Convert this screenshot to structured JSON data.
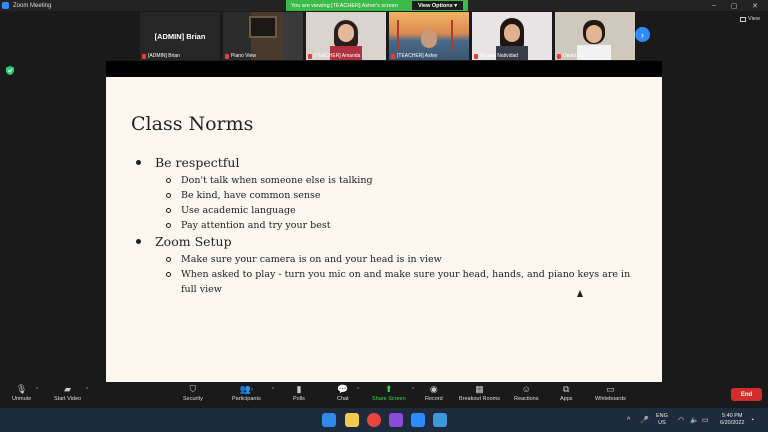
{
  "window": {
    "title": "Zoom Meeting"
  },
  "banner": {
    "text": "You are viewing [TEACHER] Asher's screen",
    "view_options": "View Options ▾"
  },
  "gallery": {
    "admin_name": "[ADMIN] Brian",
    "tiles": [
      {
        "label": "[ADMIN] Brian"
      },
      {
        "label": "Piano View"
      },
      {
        "label": "[TEACHER] Amanda"
      },
      {
        "label": "[TEACHER] Asher"
      },
      {
        "label": "Regina Natividad"
      },
      {
        "label": "David Xu"
      }
    ],
    "view_label": "View"
  },
  "slide": {
    "title": "Class Norms",
    "sections": [
      {
        "heading": "Be respectful",
        "items": [
          "Don't talk when someone else is talking",
          "Be kind, have common sense",
          "Use academic language",
          "Pay attention and try your best"
        ]
      },
      {
        "heading": "Zoom Setup",
        "items": [
          "Make sure your camera is on and your head is in view",
          "When asked to play - turn you mic on and make sure your head, hands, and piano keys are in full view"
        ]
      }
    ]
  },
  "toolbar": {
    "unmute": "Unmute",
    "start_video": "Start Video",
    "security": "Security",
    "participants": "Participants",
    "participants_count": "7",
    "polls": "Polls",
    "chat": "Chat",
    "share_screen": "Share Screen",
    "record": "Record",
    "breakout": "Breakout Rooms",
    "reactions": "Reactions",
    "apps": "Apps",
    "whiteboards": "Whiteboards",
    "end": "End",
    "colors": {
      "share_green": "#3dd65a",
      "end_red": "#d42b2b",
      "accent_blue": "#2d8cff"
    }
  },
  "taskbar": {
    "lang1": "ENG",
    "lang2": "US",
    "time": "5:40 PM",
    "date": "6/20/2022"
  }
}
